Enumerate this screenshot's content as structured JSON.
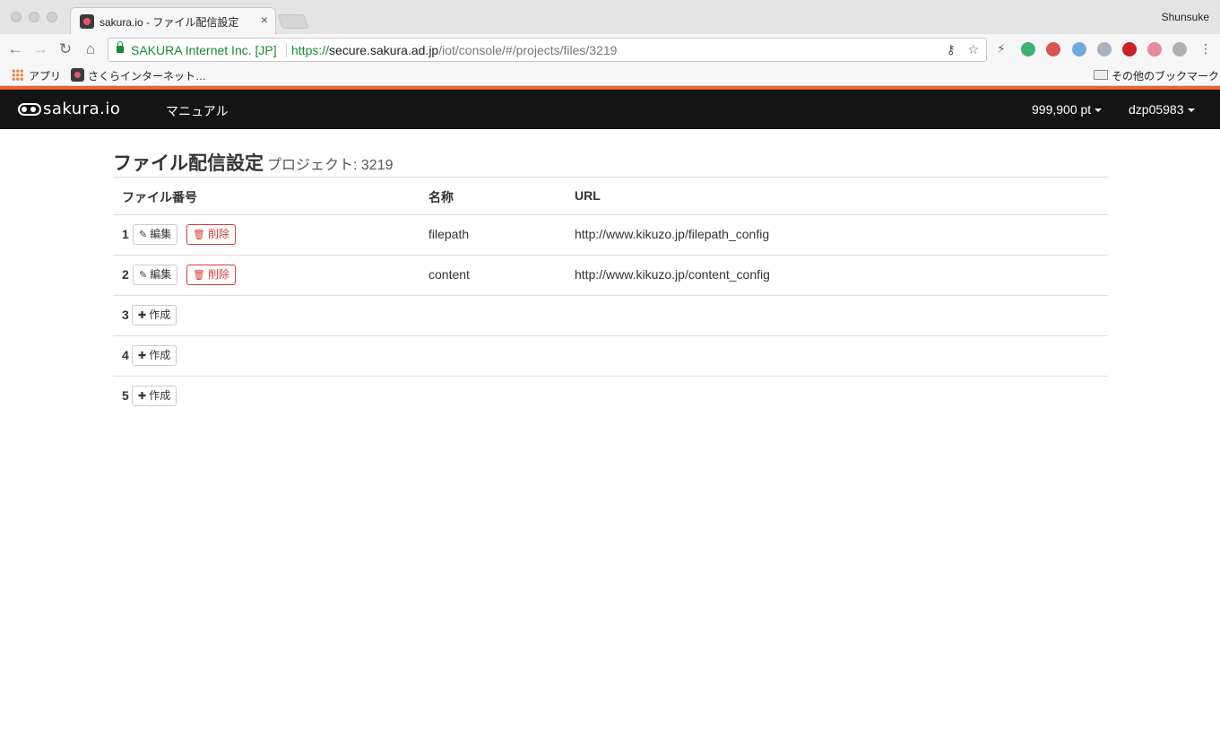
{
  "browser": {
    "tab_title": "sakura.io - ファイル配信設定",
    "tab_close": "×",
    "profile": "Shunsuke",
    "ev_label": "SAKURA Internet Inc. [JP]",
    "url_proto": "https://",
    "url_host": "secure.sakura.ad.jp",
    "url_path": "/iot/console/#/projects/files/3219",
    "bookmarks": {
      "apps": "アプリ",
      "sakura": "さくらインターネット…",
      "other": "その他のブックマーク"
    },
    "extension_colors": [
      "#7a7a7a",
      "#3cb371",
      "#d9534f",
      "#6fa8dc",
      "#aab3bd",
      "#cb2027",
      "#e8889a",
      "#b0b0b0"
    ]
  },
  "app": {
    "logo": "sakura.io",
    "nav_manual": "マニュアル",
    "points": "999,900 pt",
    "user": "dzp05983",
    "accent_color": "#e8642c"
  },
  "page": {
    "title": "ファイル配信設定",
    "subtitle": "プロジェクト: 3219"
  },
  "table": {
    "headers": {
      "number": "ファイル番号",
      "name": "名称",
      "url": "URL"
    },
    "edit_label": "編集",
    "delete_label": "削除",
    "create_label": "作成",
    "rows": [
      {
        "num": "1",
        "name": "filepath",
        "url": "http://www.kikuzo.jp/filepath_config"
      },
      {
        "num": "2",
        "name": "content",
        "url": "http://www.kikuzo.jp/content_config"
      },
      {
        "num": "3"
      },
      {
        "num": "4"
      },
      {
        "num": "5"
      }
    ]
  }
}
